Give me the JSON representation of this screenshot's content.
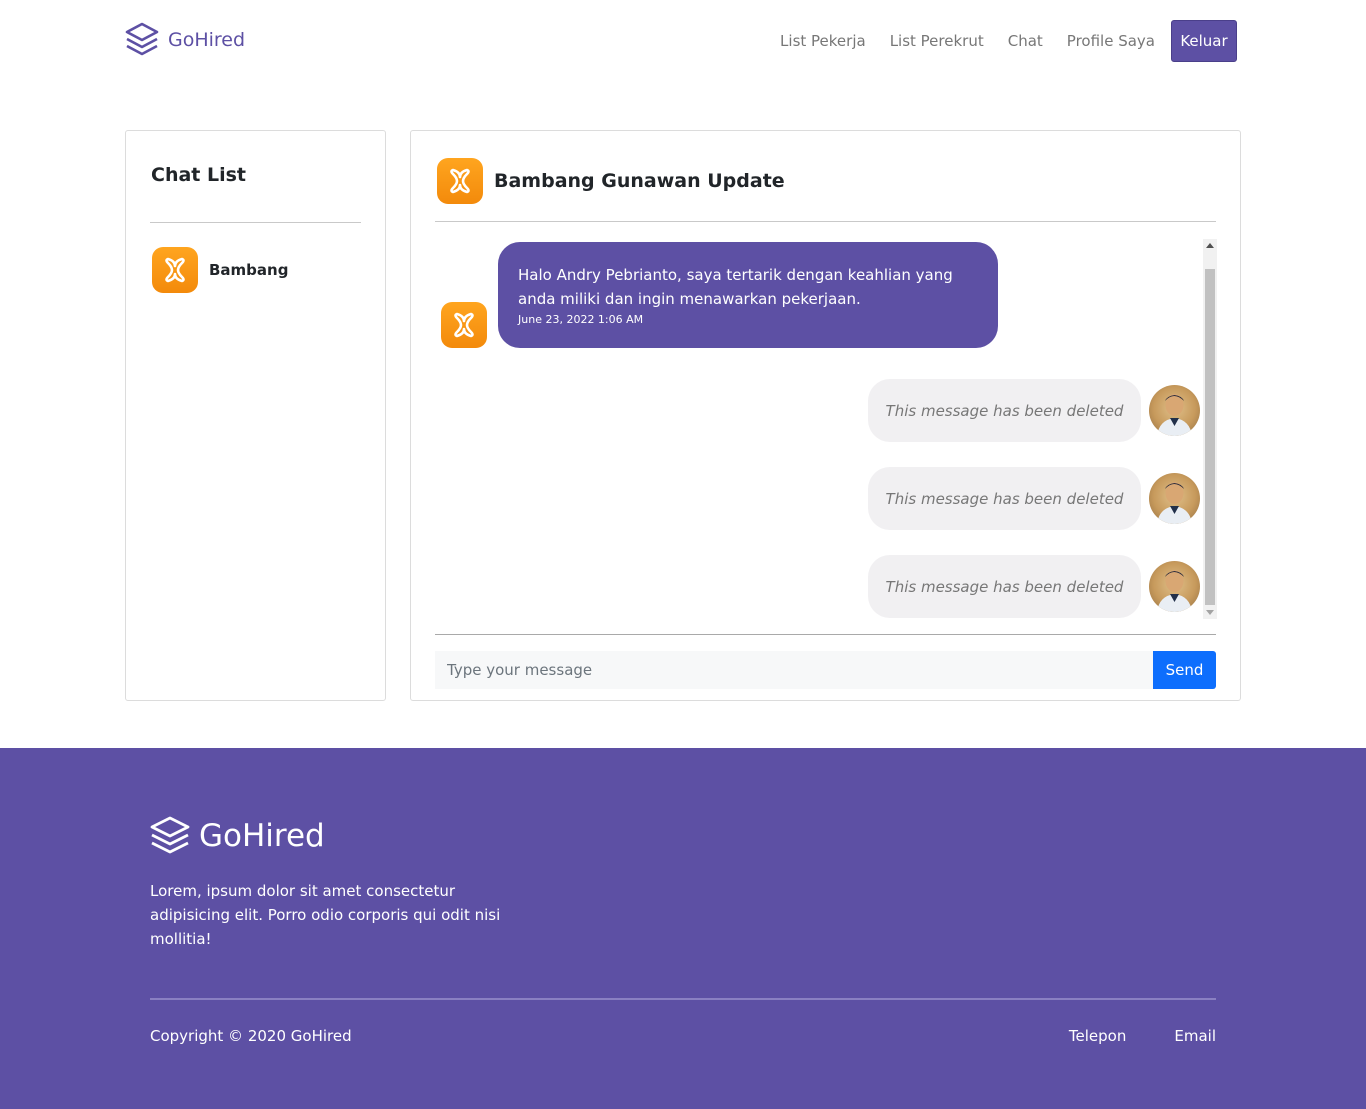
{
  "navbar": {
    "brand": "GoHired",
    "links": [
      "List Pekerja",
      "List Perekrut",
      "Chat",
      "Profile Saya"
    ],
    "logout_label": "Keluar"
  },
  "chat_list": {
    "title": "Chat List",
    "contacts": [
      {
        "name": "Bambang",
        "icon": "xampp-icon"
      }
    ]
  },
  "chat": {
    "title": "Bambang Gunawan Update",
    "messages": [
      {
        "direction": "incoming",
        "text": "Halo Andry Pebrianto, saya tertarik dengan keahlian yang anda miliki dan ingin menawarkan pekerjaan.",
        "time": "June 23, 2022 1:06 AM"
      },
      {
        "direction": "outgoing",
        "text": "This message has been deleted"
      },
      {
        "direction": "outgoing",
        "text": "This message has been deleted"
      },
      {
        "direction": "outgoing",
        "text": "This message has been deleted"
      }
    ],
    "input_placeholder": "Type your message",
    "send_label": "Send"
  },
  "footer": {
    "brand": "GoHired",
    "description": "Lorem, ipsum dolor sit amet consectetur adipisicing elit. Porro odio corporis qui odit nisi mollitia!",
    "copyright": "Copyright © 2020 GoHired",
    "links": [
      "Telepon",
      "Email"
    ]
  },
  "colors": {
    "brand": "#5d50a4",
    "send_button": "#0d6efd",
    "icon_orange": "#f7941d"
  }
}
